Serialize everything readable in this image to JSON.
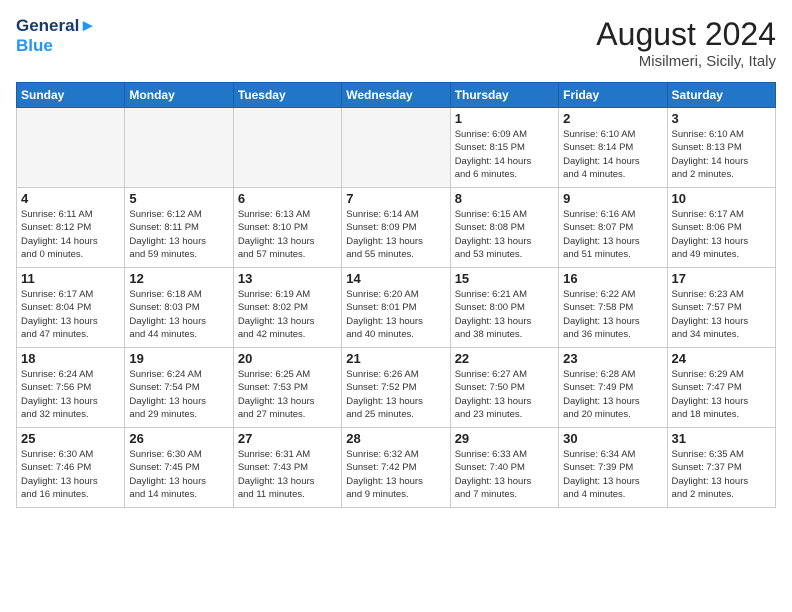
{
  "header": {
    "logo_line1": "General",
    "logo_line2": "Blue",
    "month_year": "August 2024",
    "location": "Misilmeri, Sicily, Italy"
  },
  "weekdays": [
    "Sunday",
    "Monday",
    "Tuesday",
    "Wednesday",
    "Thursday",
    "Friday",
    "Saturday"
  ],
  "weeks": [
    [
      {
        "day": "",
        "info": ""
      },
      {
        "day": "",
        "info": ""
      },
      {
        "day": "",
        "info": ""
      },
      {
        "day": "",
        "info": ""
      },
      {
        "day": "1",
        "info": "Sunrise: 6:09 AM\nSunset: 8:15 PM\nDaylight: 14 hours\nand 6 minutes."
      },
      {
        "day": "2",
        "info": "Sunrise: 6:10 AM\nSunset: 8:14 PM\nDaylight: 14 hours\nand 4 minutes."
      },
      {
        "day": "3",
        "info": "Sunrise: 6:10 AM\nSunset: 8:13 PM\nDaylight: 14 hours\nand 2 minutes."
      }
    ],
    [
      {
        "day": "4",
        "info": "Sunrise: 6:11 AM\nSunset: 8:12 PM\nDaylight: 14 hours\nand 0 minutes."
      },
      {
        "day": "5",
        "info": "Sunrise: 6:12 AM\nSunset: 8:11 PM\nDaylight: 13 hours\nand 59 minutes."
      },
      {
        "day": "6",
        "info": "Sunrise: 6:13 AM\nSunset: 8:10 PM\nDaylight: 13 hours\nand 57 minutes."
      },
      {
        "day": "7",
        "info": "Sunrise: 6:14 AM\nSunset: 8:09 PM\nDaylight: 13 hours\nand 55 minutes."
      },
      {
        "day": "8",
        "info": "Sunrise: 6:15 AM\nSunset: 8:08 PM\nDaylight: 13 hours\nand 53 minutes."
      },
      {
        "day": "9",
        "info": "Sunrise: 6:16 AM\nSunset: 8:07 PM\nDaylight: 13 hours\nand 51 minutes."
      },
      {
        "day": "10",
        "info": "Sunrise: 6:17 AM\nSunset: 8:06 PM\nDaylight: 13 hours\nand 49 minutes."
      }
    ],
    [
      {
        "day": "11",
        "info": "Sunrise: 6:17 AM\nSunset: 8:04 PM\nDaylight: 13 hours\nand 47 minutes."
      },
      {
        "day": "12",
        "info": "Sunrise: 6:18 AM\nSunset: 8:03 PM\nDaylight: 13 hours\nand 44 minutes."
      },
      {
        "day": "13",
        "info": "Sunrise: 6:19 AM\nSunset: 8:02 PM\nDaylight: 13 hours\nand 42 minutes."
      },
      {
        "day": "14",
        "info": "Sunrise: 6:20 AM\nSunset: 8:01 PM\nDaylight: 13 hours\nand 40 minutes."
      },
      {
        "day": "15",
        "info": "Sunrise: 6:21 AM\nSunset: 8:00 PM\nDaylight: 13 hours\nand 38 minutes."
      },
      {
        "day": "16",
        "info": "Sunrise: 6:22 AM\nSunset: 7:58 PM\nDaylight: 13 hours\nand 36 minutes."
      },
      {
        "day": "17",
        "info": "Sunrise: 6:23 AM\nSunset: 7:57 PM\nDaylight: 13 hours\nand 34 minutes."
      }
    ],
    [
      {
        "day": "18",
        "info": "Sunrise: 6:24 AM\nSunset: 7:56 PM\nDaylight: 13 hours\nand 32 minutes."
      },
      {
        "day": "19",
        "info": "Sunrise: 6:24 AM\nSunset: 7:54 PM\nDaylight: 13 hours\nand 29 minutes."
      },
      {
        "day": "20",
        "info": "Sunrise: 6:25 AM\nSunset: 7:53 PM\nDaylight: 13 hours\nand 27 minutes."
      },
      {
        "day": "21",
        "info": "Sunrise: 6:26 AM\nSunset: 7:52 PM\nDaylight: 13 hours\nand 25 minutes."
      },
      {
        "day": "22",
        "info": "Sunrise: 6:27 AM\nSunset: 7:50 PM\nDaylight: 13 hours\nand 23 minutes."
      },
      {
        "day": "23",
        "info": "Sunrise: 6:28 AM\nSunset: 7:49 PM\nDaylight: 13 hours\nand 20 minutes."
      },
      {
        "day": "24",
        "info": "Sunrise: 6:29 AM\nSunset: 7:47 PM\nDaylight: 13 hours\nand 18 minutes."
      }
    ],
    [
      {
        "day": "25",
        "info": "Sunrise: 6:30 AM\nSunset: 7:46 PM\nDaylight: 13 hours\nand 16 minutes."
      },
      {
        "day": "26",
        "info": "Sunrise: 6:30 AM\nSunset: 7:45 PM\nDaylight: 13 hours\nand 14 minutes."
      },
      {
        "day": "27",
        "info": "Sunrise: 6:31 AM\nSunset: 7:43 PM\nDaylight: 13 hours\nand 11 minutes."
      },
      {
        "day": "28",
        "info": "Sunrise: 6:32 AM\nSunset: 7:42 PM\nDaylight: 13 hours\nand 9 minutes."
      },
      {
        "day": "29",
        "info": "Sunrise: 6:33 AM\nSunset: 7:40 PM\nDaylight: 13 hours\nand 7 minutes."
      },
      {
        "day": "30",
        "info": "Sunrise: 6:34 AM\nSunset: 7:39 PM\nDaylight: 13 hours\nand 4 minutes."
      },
      {
        "day": "31",
        "info": "Sunrise: 6:35 AM\nSunset: 7:37 PM\nDaylight: 13 hours\nand 2 minutes."
      }
    ]
  ]
}
